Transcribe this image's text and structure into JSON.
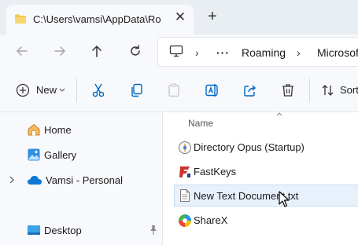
{
  "tab": {
    "title": "C:\\Users\\vamsi\\AppData\\Roaming",
    "close_glyph": "✕",
    "new_tab_glyph": "+"
  },
  "nav": {
    "more_glyph": "···",
    "sep_glyph": "›",
    "crumbs": [
      "Roaming",
      "Microsof"
    ]
  },
  "toolbar": {
    "new_label": "New",
    "sort_label": "Sort"
  },
  "sidebar": {
    "items": [
      {
        "label": "Home",
        "icon": "home-icon"
      },
      {
        "label": "Gallery",
        "icon": "gallery-icon"
      },
      {
        "label": "Vamsi - Personal",
        "icon": "cloud-icon",
        "expandable": true
      },
      {
        "label": "Desktop",
        "icon": "desktop-icon",
        "pinned": true
      }
    ]
  },
  "content": {
    "column_header": "Name",
    "files": [
      {
        "name": "Directory Opus (Startup)",
        "icon": "directory-opus-icon"
      },
      {
        "name": "FastKeys",
        "icon": "fastkeys-icon"
      },
      {
        "name": "New Text Document.txt",
        "icon": "text-document-icon",
        "selected": true
      },
      {
        "name": "ShareX",
        "icon": "sharex-icon"
      }
    ]
  },
  "colors": {
    "accent": "#0067c0",
    "folder": "#f2c94c",
    "selection": "#e8f1fb"
  }
}
